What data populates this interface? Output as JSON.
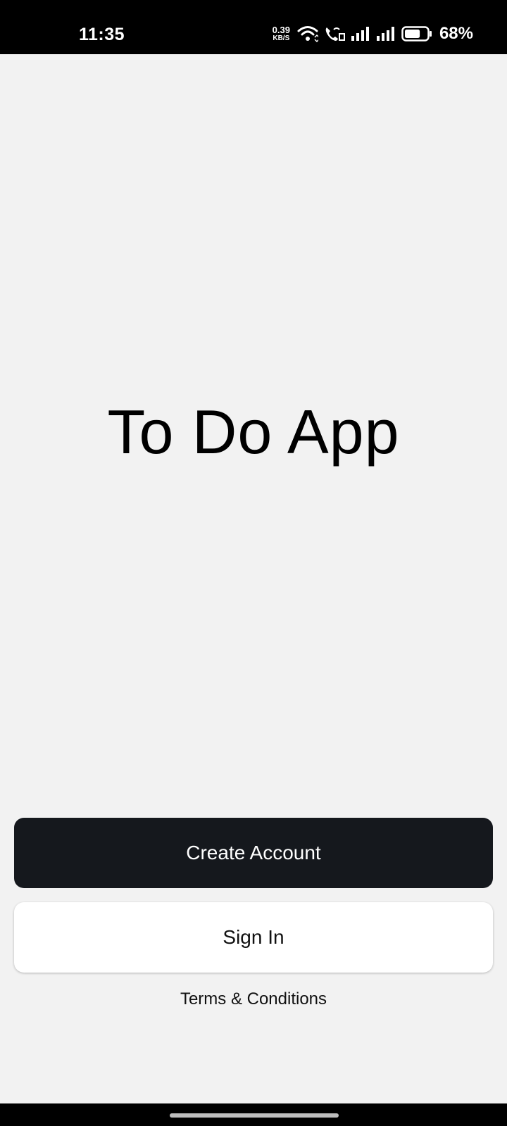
{
  "status_bar": {
    "time": "11:35",
    "net_speed_value": "0.39",
    "net_speed_unit": "KB/S",
    "battery_percent": "68%",
    "battery_level": 0.68,
    "icons": [
      "wifi-icon",
      "vowifi-call-icon",
      "signal-icon",
      "signal-icon",
      "battery-icon"
    ]
  },
  "main": {
    "title": "To Do App",
    "create_account_label": "Create Account",
    "sign_in_label": "Sign In",
    "terms_label": "Terms & Conditions"
  },
  "colors": {
    "background": "#f2f2f2",
    "primary_button": "#15181d",
    "secondary_button": "#ffffff",
    "status_bar": "#000000"
  }
}
